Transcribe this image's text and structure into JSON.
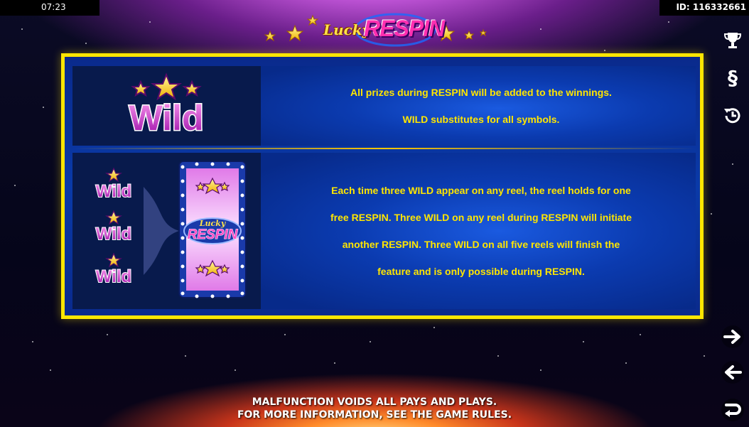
{
  "status_bar": {
    "clock": "07:23",
    "session_id": "ID: 116332661"
  },
  "logo": {
    "lucky": "Lucky",
    "respin": "RESPIN"
  },
  "rules": [
    {
      "symbol_text": "Wild",
      "lines": [
        "All prizes during RESPIN will be added to the winnings.",
        "WILD substitutes for all symbols."
      ]
    },
    {
      "symbol_text": "Wild",
      "reel_text_lucky": "Lucky",
      "reel_text_respin": "RESPIN",
      "lines": [
        "Each time three WILD appear on any reel, the reel holds for one",
        "free RESPIN. Three WILD on any reel during RESPIN will initiate",
        "another RESPIN. Three WILD on all five reels will finish the",
        "feature and is only possible during RESPIN."
      ]
    }
  ],
  "side_buttons": {
    "top": [
      "trophy-icon",
      "paragraph-icon",
      "history-icon"
    ],
    "bottom": [
      "arrow-right-icon",
      "arrow-left-icon",
      "return-icon"
    ],
    "paragraph_glyph": "§"
  },
  "footer": {
    "line1": "MALFUNCTION VOIDS ALL PAYS AND PLAYS.",
    "line2": "FOR MORE INFORMATION, SEE THE GAME RULES."
  },
  "colors": {
    "accent_yellow": "#ffe600",
    "panel_blue": "#0a3aa8",
    "wild_magenta": "#c21cc8"
  }
}
